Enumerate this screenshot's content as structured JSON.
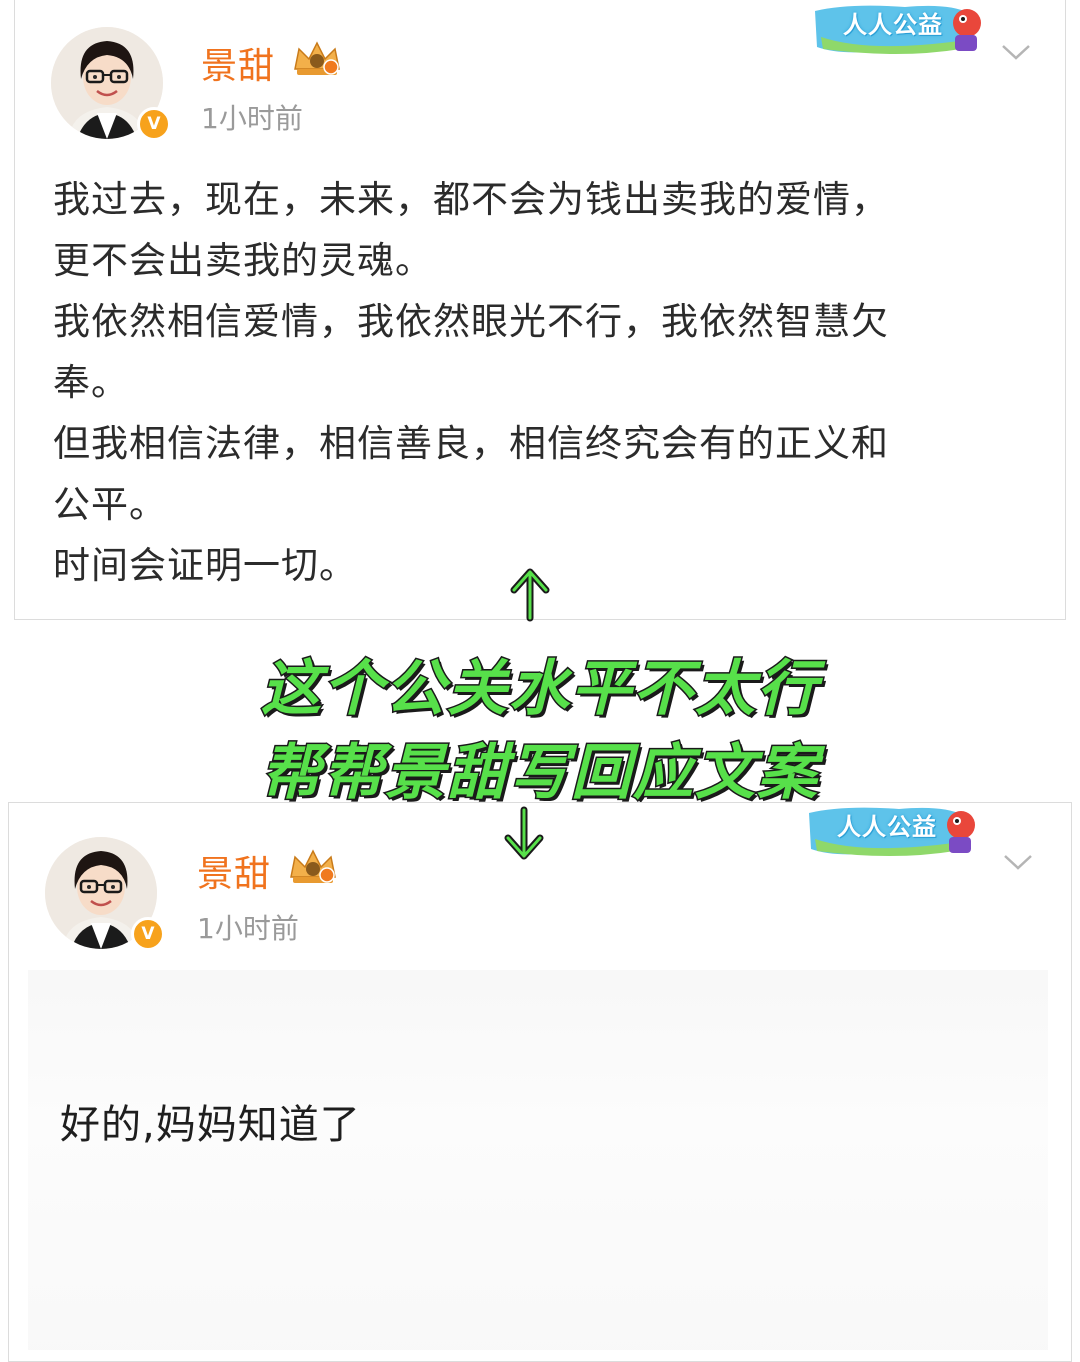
{
  "top_post": {
    "username": "景甜",
    "timestamp": "1小时前",
    "banner_text": "人人公益",
    "body_lines": [
      "我过去，现在，未来，都不会为钱出卖我的爱情，",
      "更不会出卖我的灵魂。",
      "我依然相信爱情，我依然眼光不行，我依然智慧欠",
      "奉。",
      "但我相信法律，相信善良，相信终究会有的正义和",
      "公平。",
      "时间会证明一切。"
    ]
  },
  "caption": {
    "line1": "这个公关水平不太行",
    "line2": "帮帮景甜写回应文案"
  },
  "bottom_post": {
    "username": "景甜",
    "timestamp": "1小时前",
    "banner_text": "人人公益",
    "body": "好的,妈妈知道了"
  },
  "colors": {
    "username": "#f0731e",
    "timestamp": "#9a9a9a",
    "caption_fill": "#57e04a",
    "caption_stroke": "#1a1a1a",
    "verified_badge": "#f7a21c"
  },
  "icons": {
    "verified": "verified-v-icon",
    "crown": "crown-level-icon",
    "chevron": "chevron-down-icon",
    "arrow_up": "arrow-up-icon",
    "arrow_down": "arrow-down-icon"
  }
}
